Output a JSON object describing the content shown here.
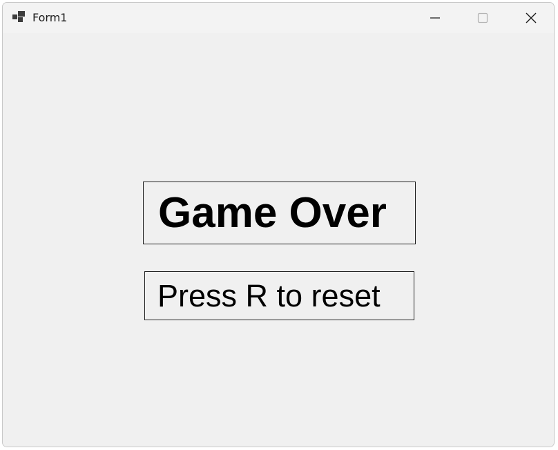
{
  "window": {
    "title": "Form1",
    "icon": "form-app-icon",
    "controls": {
      "minimize_icon": "minimize-icon",
      "maximize_icon": "maximize-icon",
      "close_icon": "close-icon"
    }
  },
  "client": {
    "game_over_label": "Game Over",
    "reset_hint_label": "Press R to reset"
  },
  "colors": {
    "window_background": "#f0f0f0",
    "titlebar_background": "#f3f3f3",
    "text": "#000000",
    "label_border": "#1e1e1e"
  }
}
